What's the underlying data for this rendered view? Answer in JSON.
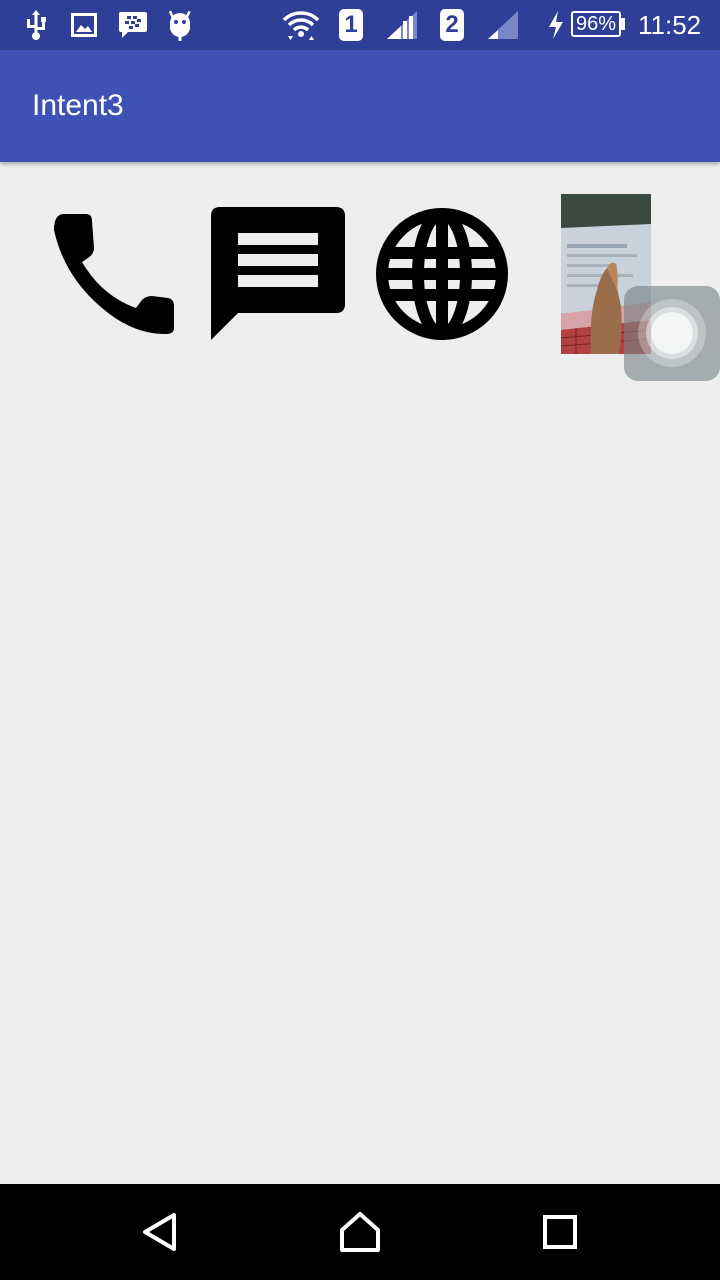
{
  "status_bar": {
    "left_icons": [
      "usb-icon",
      "image-icon",
      "blackberry-messenger-icon",
      "android-debug-icon"
    ],
    "sim1_label": "1",
    "sim2_label": "2",
    "battery_percent": "96%",
    "charging": true,
    "time": "11:52"
  },
  "app_bar": {
    "title": "Intent3",
    "background_color": "#3f51b5",
    "status_color": "#2f3f97"
  },
  "content": {
    "icons": [
      "phone-icon",
      "message-icon",
      "globe-icon",
      "photo-thumbnail"
    ],
    "background_color": "#eeeeee"
  },
  "navigation_bar": {
    "buttons": [
      "back-icon",
      "home-icon",
      "recents-icon"
    ]
  }
}
